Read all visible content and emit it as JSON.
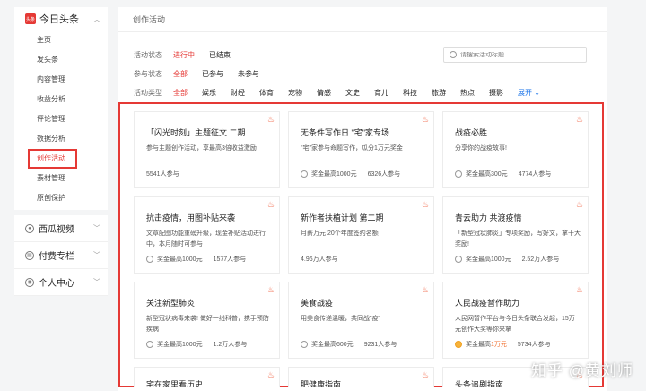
{
  "sidebar": {
    "app_title": "今日头条",
    "logo_text": "头条",
    "items": [
      "主页",
      "发头条",
      "内容管理",
      "收益分析",
      "评论管理",
      "数据分析",
      "创作活动",
      "素材管理",
      "原创保护"
    ],
    "sections": [
      {
        "label": "西瓜视频",
        "icon": "watermelon-icon"
      },
      {
        "label": "付费专栏",
        "icon": "paid-column-icon"
      },
      {
        "label": "个人中心",
        "icon": "user-icon"
      }
    ]
  },
  "main": {
    "title": "创作活动",
    "filters": {
      "status": {
        "label": "活动状态",
        "options": [
          "进行中",
          "已结束"
        ]
      },
      "join": {
        "label": "参与状态",
        "options": [
          "全部",
          "已参与",
          "未参与"
        ]
      },
      "type": {
        "label": "活动类型",
        "options": [
          "全部",
          "娱乐",
          "财经",
          "体育",
          "宠物",
          "情感",
          "文史",
          "育儿",
          "科技",
          "旅游",
          "热点",
          "摄影"
        ],
        "expand": "展开 ⌄"
      }
    },
    "search_placeholder": "请搜索活动标题",
    "cards": [
      {
        "title": "「闪光时刻」主题征文 二期",
        "desc": "参与主题创作活动，享最高3倍收益激励",
        "meta1": "",
        "meta2": "5541人参与"
      },
      {
        "title": "无条件写作日 \"宅\"家专场",
        "desc": "\"宅\"家参与命题写作，瓜分1万元奖金",
        "meta1": "奖金最高1000元",
        "meta2": "6326人参与"
      },
      {
        "title": "战疫必胜",
        "desc": "分享你的战疫故事!",
        "meta1": "奖金最高300元",
        "meta2": "4774人参与"
      },
      {
        "title": "抗击疫情，用图补贴来袭",
        "desc": "文章配图功能重磅升级，现金补贴活动进行中，本月随时可参与",
        "meta1": "奖金最高1000元",
        "meta2": "1577人参与"
      },
      {
        "title": "新作者扶植计划 第二期",
        "desc": "月薪万元 20个年度签约名额",
        "meta1": "",
        "meta2": "4.96万人参与"
      },
      {
        "title": "青云助力 共渡疫情",
        "desc": "「新型冠状肺炎」专项奖励，写好文，拿十大奖励!",
        "meta1": "奖金最高1000元",
        "meta2": "2.52万人参与"
      },
      {
        "title": "关注新型肺炎",
        "desc": "新型冠状病毒来袭! 做好一线科普，携手预防疾病",
        "meta1": "奖金最高1000元",
        "meta2": "1.2万人参与"
      },
      {
        "title": "美食战疫",
        "desc": "用美食传递温暖，共同战\"疫\"",
        "meta1": "奖金最高600元",
        "meta2": "9231人参与"
      },
      {
        "title": "人民战疫暂作助力",
        "desc": "人民网暂作平台与今日头条联合发起，15万元创作大奖等你来拿",
        "meta1": "奖金最高",
        "meta1_hot": "1万元",
        "meta2": "5734人参与"
      },
      {
        "title": "宅在家里看历史",
        "desc": "",
        "meta1": "",
        "meta2": ""
      },
      {
        "title": "肥健康指南",
        "desc": "",
        "meta1": "",
        "meta2": ""
      },
      {
        "title": "头条追剧指南",
        "desc": "",
        "meta1": "",
        "meta2": ""
      }
    ]
  },
  "watermark": "知乎 @黄刘师",
  "colors": {
    "accent": "#e53935",
    "link": "#1a73e8"
  }
}
